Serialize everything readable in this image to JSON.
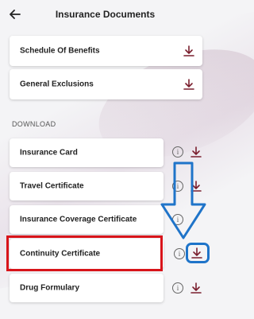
{
  "header": {
    "title": "Insurance Documents",
    "back_icon": "back-arrow-icon"
  },
  "documents_top": [
    {
      "label": "Schedule Of Benefits"
    },
    {
      "label": "General Exclusions"
    }
  ],
  "download_section": {
    "label": "DOWNLOAD",
    "items": [
      {
        "label": "Insurance Card"
      },
      {
        "label": "Travel Certificate"
      },
      {
        "label": "Insurance Coverage Certificate"
      },
      {
        "label": "Continuity Certificate"
      },
      {
        "label": "Drug Formulary"
      }
    ]
  },
  "icons": {
    "info": "i",
    "download": "download-icon"
  },
  "colors": {
    "download_icon": "#7a1f2e",
    "highlight_red": "#d8141a",
    "annotation_blue": "#1f74c9"
  }
}
